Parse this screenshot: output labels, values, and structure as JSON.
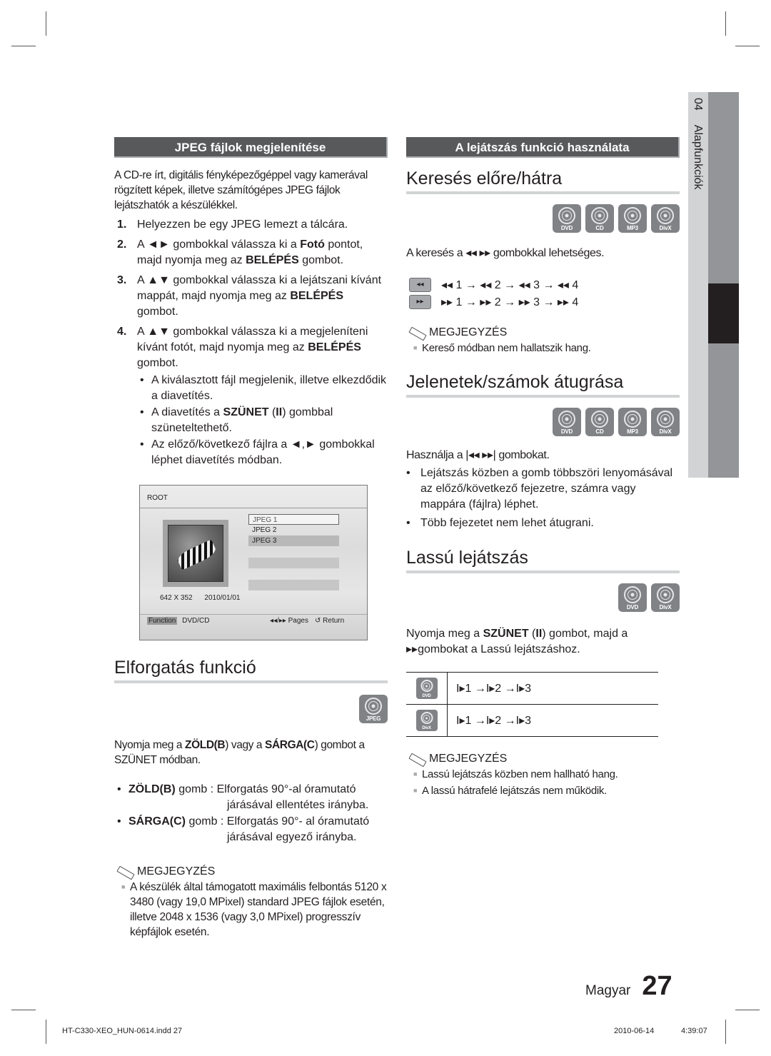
{
  "left": {
    "section_title": "JPEG fájlok megjelenítése",
    "intro": "A CD-re írt, digitális fényképezőgéppel vagy kamerával rögzített képek, illetve számítógépes JPEG fájlok lejátszhatók a készülékkel.",
    "steps": [
      {
        "num": "1.",
        "parts": [
          "Helyezzen be egy JPEG lemezt a tálcára."
        ]
      },
      {
        "num": "2.",
        "pre": "A ◄► gombokkal válassza ki a ",
        "b1": "Fotó",
        "mid": " pontot, majd nyomja meg az ",
        "b2": "BELÉPÉS",
        "post": " gombot."
      },
      {
        "num": "3.",
        "pre": "A ▲▼ gombokkal válassza ki a lejátszani kívánt mappát, majd nyomja meg az ",
        "b2": "BELÉPÉS",
        "post": " gombot."
      },
      {
        "num": "4.",
        "pre": "A ▲▼ gombokkal válassza ki a megjeleníteni kívánt fotót, majd nyomja meg az ",
        "b2": "BELÉPÉS",
        "post": " gombot."
      }
    ],
    "bullets": [
      {
        "text": "A kiválasztott fájl megjelenik, illetve elkezdődik a diavetítés."
      },
      {
        "pre": "A diavetítés a ",
        "b": "SZÜNET",
        "mid": " (",
        "b2": "II",
        "post": ") gombbal szüneteltethető."
      },
      {
        "text": "Az előző/következő fájlra a ◄,► gombokkal léphet diavetítés módban."
      }
    ],
    "osd": {
      "root_label": "ROOT",
      "files": [
        "JPEG 1",
        "JPEG 2",
        "JPEG 3"
      ],
      "resolution": "642 X 352",
      "date": "2010/01/01",
      "function_label": "Function",
      "source_label": "DVD/CD",
      "pages_label": "◂◂/▸▸ Pages",
      "return_label": "↺ Return"
    },
    "rotate": {
      "title": "Elforgatás funkció",
      "icon_label": "JPEG",
      "intro_pre": "Nyomja meg a ",
      "intro_b1": "ZÖLD(B",
      "intro_mid": ") vagy a ",
      "intro_b2": "SÁRGA(C",
      "intro_post": ") gombot a SZÜNET módban.",
      "items": [
        {
          "key": "ZÖLD(B)",
          "text": " gomb : Elforgatás 90°-al óramutató",
          "cont": "járásával ellentétes irányba."
        },
        {
          "key": "SÁRGA(C)",
          "text": " gomb : Elforgatás 90°- al óramutató",
          "cont": "járásával egyező irányba."
        }
      ],
      "note_title": "MEGJEGYZÉS",
      "notes": [
        "A készülék által támogatott maximális felbontás 5120 x 3480 (vagy 19,0 MPixel) standard JPEG fájlok esetén, illetve 2048 x 1536 (vagy 3,0 MPixel) progresszív képfájlok esetén."
      ]
    }
  },
  "right": {
    "section_title": "A lejátszás funkció használata",
    "search": {
      "title": "Keresés előre/hátra",
      "icons": [
        "DVD",
        "CD",
        "MP3",
        "DivX"
      ],
      "intro": "A keresés a ◂◂ ▸▸  gombokkal lehetséges.",
      "rows": [
        {
          "btn": "◂◂",
          "seq": "◂◂ 1 → ◂◂ 2 → ◂◂ 3 → ◂◂ 4"
        },
        {
          "btn": "▸▸",
          "seq": "▸▸ 1 → ▸▸ 2 → ▸▸ 3 → ▸▸ 4"
        }
      ],
      "note_title": "MEGJEGYZÉS",
      "notes": [
        "Kereső módban nem hallatszik hang."
      ]
    },
    "skip": {
      "title": "Jelenetek/számok átugrása",
      "icons": [
        "DVD",
        "CD",
        "MP3",
        "DivX"
      ],
      "intro": "Használja a |◂◂ ▸▸| gombokat.",
      "bullets": [
        "Lejátszás közben a gomb többszöri lenyomásával az előző/következő fejezetre, számra vagy mappára (fájlra) léphet.",
        "Több fejezetet nem lehet átugrani."
      ]
    },
    "slow": {
      "title": "Lassú lejátszás",
      "icons": [
        "DVD",
        "DivX"
      ],
      "intro_pre": "Nyomja meg a ",
      "intro_b": "SZÜNET",
      "intro_mid": " (",
      "intro_b2": "II",
      "intro_post": ") gombot, majd a ▸▸gombokat a Lassú lejátszáshoz.",
      "rows": [
        {
          "icon": "DVD",
          "seq": "I▸1 →I▸2 →I▸3"
        },
        {
          "icon": "DivX",
          "seq": "I▸1 →I▸2 →I▸3"
        }
      ],
      "note_title": "MEGJEGYZÉS",
      "notes": [
        "Lassú lejátszás közben nem hallható hang.",
        "A lassú hátrafelé lejátszás nem működik."
      ]
    }
  },
  "side_tab": {
    "chapter": "04",
    "label": "Alapfunkciók"
  },
  "page": {
    "language": "Magyar",
    "number": "27"
  },
  "footer": {
    "file": "HT-C330-XEO_HUN-0614.indd   27",
    "date": "2010-06-14",
    "time": "4:39:07"
  }
}
